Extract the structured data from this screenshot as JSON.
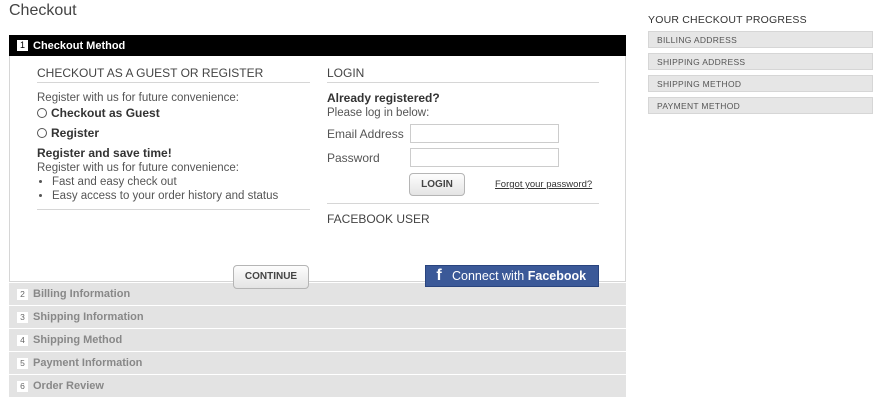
{
  "page_title": "Checkout",
  "steps": [
    {
      "num": "1",
      "label": "Checkout Method"
    },
    {
      "num": "2",
      "label": "Billing Information"
    },
    {
      "num": "3",
      "label": "Shipping Information"
    },
    {
      "num": "4",
      "label": "Shipping Method"
    },
    {
      "num": "5",
      "label": "Payment Information"
    },
    {
      "num": "6",
      "label": "Order Review"
    }
  ],
  "guest": {
    "heading": "CHECKOUT AS A GUEST OR REGISTER",
    "intro": "Register with us for future convenience:",
    "option_guest": "Checkout as Guest",
    "option_register": "Register",
    "save_time": "Register and save time!",
    "intro2": "Register with us for future convenience:",
    "benefits": [
      "Fast and easy check out",
      "Easy access to your order history and status"
    ],
    "continue_label": "CONTINUE"
  },
  "login": {
    "heading": "LOGIN",
    "already": "Already registered?",
    "please": "Please log in below:",
    "email_label": "Email Address",
    "email_value": "",
    "password_label": "Password",
    "password_value": "",
    "login_label": "LOGIN",
    "forgot_label": "Forgot your password?"
  },
  "facebook": {
    "heading": "FACEBOOK USER",
    "icon": "f",
    "connect_pre": "Connect with",
    "connect_brand": "Facebook",
    "color": "#3b5998"
  },
  "progress": {
    "title": "YOUR CHECKOUT PROGRESS",
    "items": [
      "BILLING ADDRESS",
      "SHIPPING ADDRESS",
      "SHIPPING METHOD",
      "PAYMENT METHOD"
    ]
  }
}
